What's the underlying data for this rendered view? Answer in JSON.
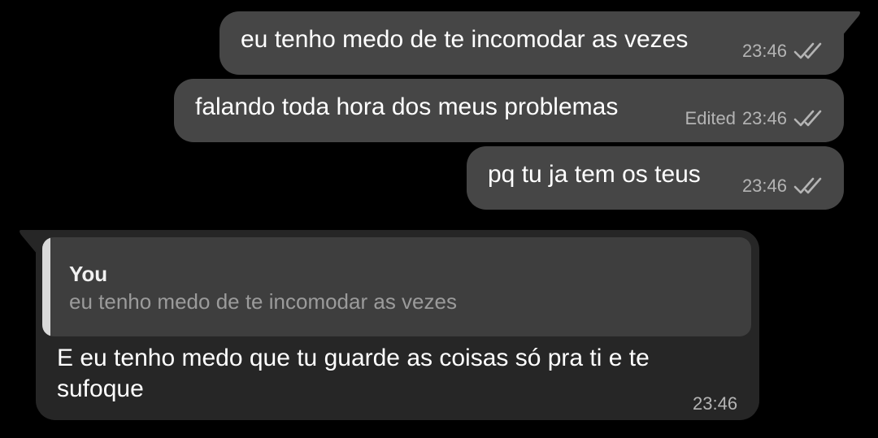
{
  "messages": [
    {
      "text": "eu tenho medo de te incomodar as vezes",
      "time": "23:46",
      "edited": "",
      "status": "read-double-check-icon"
    },
    {
      "text": "falando toda hora dos meus problemas",
      "time": "23:46",
      "edited": "Edited",
      "status": "read-double-check-icon"
    },
    {
      "text": "pq tu ja tem os teus",
      "time": "23:46",
      "edited": "",
      "status": "read-double-check-icon"
    }
  ],
  "reply": {
    "quote_author": "You",
    "quote_text": "eu tenho medo de te incomodar as vezes",
    "text": "E eu tenho medo que tu guarde as coisas só pra ti e te sufoque",
    "time": "23:46"
  },
  "colors": {
    "background": "#000000",
    "outgoing_bubble": "#464646",
    "incoming_bubble": "#262626",
    "quote_bar": "#d9d9d9"
  }
}
